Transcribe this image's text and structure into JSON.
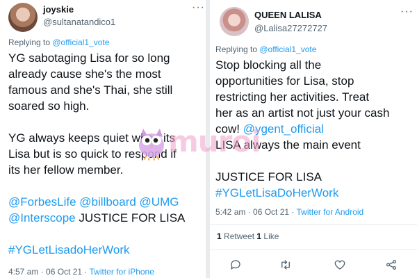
{
  "left": {
    "name": "joyskie",
    "handle": "@sultanatandico1",
    "reply_prefix": "Replying to ",
    "reply_to": "@official1_vote",
    "lines": [
      [
        {
          "t": "YG sabotaging Lisa for so long"
        }
      ],
      [
        {
          "t": "already cause she's the most"
        }
      ],
      [
        {
          "t": "famous and she's Thai, she still"
        }
      ],
      [
        {
          "t": "soared so high."
        }
      ],
      [
        {
          "t": ""
        }
      ],
      [
        {
          "t": "YG always keeps quiet when its"
        }
      ],
      [
        {
          "t": "Lisa but is so quick to respond if"
        }
      ],
      [
        {
          "t": "its her fellow member."
        }
      ],
      [
        {
          "t": ""
        }
      ],
      [
        {
          "t": "@ForbesLife @billboard @UMG",
          "link": true
        }
      ],
      [
        {
          "t": "@Interscope",
          "link": true
        },
        {
          "t": " JUSTICE FOR LISA"
        }
      ],
      [
        {
          "t": ""
        }
      ],
      [
        {
          "t": "#YGLetLisadoHerWork",
          "link": true
        }
      ]
    ],
    "time": "4:57 am · 06 Oct 21 · ",
    "source": "Twitter for iPhone"
  },
  "right": {
    "name": "QUEEN LALISA",
    "handle": "@Lalisa27272727",
    "reply_prefix": "Replying to ",
    "reply_to": "@official1_vote",
    "lines": [
      [
        {
          "t": "Stop blocking all the"
        }
      ],
      [
        {
          "t": "opportunities for Lisa, stop"
        }
      ],
      [
        {
          "t": "restricting her activities. Treat"
        }
      ],
      [
        {
          "t": "her as an artist not just your cash"
        }
      ],
      [
        {
          "t": "cow! "
        },
        {
          "t": "@ygent_official",
          "link": true
        }
      ],
      [
        {
          "t": "LISA always the main event"
        }
      ],
      [
        {
          "t": ""
        }
      ],
      [
        {
          "t": "JUSTICE FOR LISA"
        }
      ],
      [
        {
          "t": "#YGLetLisaDoHerWork",
          "link": true
        }
      ]
    ],
    "time": "5:42 am · 06 Oct 21 · ",
    "source": "Twitter for Android",
    "retweets": "1",
    "retweets_label": " Retweet  ",
    "likes": "1",
    "likes_label": " Like"
  },
  "watermark": "muroi",
  "icons": [
    "more-icon",
    "reply-icon",
    "retweet-icon",
    "like-icon",
    "share-icon",
    "owl-icon"
  ],
  "colors": {
    "link": "#1d9bf0",
    "muted": "#536471",
    "text": "#0f1419"
  }
}
